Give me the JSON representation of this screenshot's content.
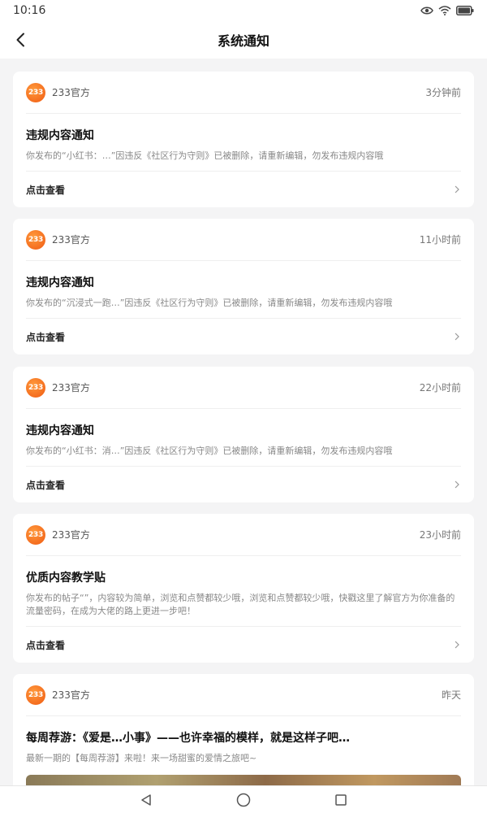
{
  "status_bar": {
    "time": "10:16",
    "icons": [
      "eye-icon",
      "wifi-icon",
      "battery-icon"
    ]
  },
  "header": {
    "title": "系统通知",
    "back_icon": "back-arrow-icon"
  },
  "notifications": [
    {
      "sender": "233官方",
      "avatar_text": "233",
      "time": "3分钟前",
      "title": "违规内容通知",
      "text": "你发布的“小红书：…”因违反《社区行为守则》已被删除，请重新编辑，勿发布违规内容哦",
      "action": "点击查看"
    },
    {
      "sender": "233官方",
      "avatar_text": "233",
      "time": "11小时前",
      "title": "违规内容通知",
      "text": "你发布的“沉浸式一跑…”因违反《社区行为守则》已被删除，请重新编辑，勿发布违规内容哦",
      "action": "点击查看"
    },
    {
      "sender": "233官方",
      "avatar_text": "233",
      "time": "22小时前",
      "title": "违规内容通知",
      "text": "你发布的“小红书：消…”因违反《社区行为守则》已被删除，请重新编辑，勿发布违规内容哦",
      "action": "点击查看"
    },
    {
      "sender": "233官方",
      "avatar_text": "233",
      "time": "23小时前",
      "title": "优质内容教学贴",
      "text": "你发布的帖子“”，内容较为简单，浏览和点赞都较少哦，浏览和点赞都较少哦，快戳这里了解官方为你准备的流量密码，在成为大佬的路上更进一步吧！",
      "action": "点击查看"
    },
    {
      "sender": "233官方",
      "avatar_text": "233",
      "time": "昨天",
      "title": "每周荐游：《爱是…小事》——也许幸福的模样，就是这样子吧…",
      "text": "最新一期的【每周荐游】来啦！来一场甜蜜的爱情之旅吧~"
    }
  ],
  "nav_bar": {
    "icons": [
      "back-triangle-icon",
      "home-circle-icon",
      "recents-square-icon"
    ]
  }
}
